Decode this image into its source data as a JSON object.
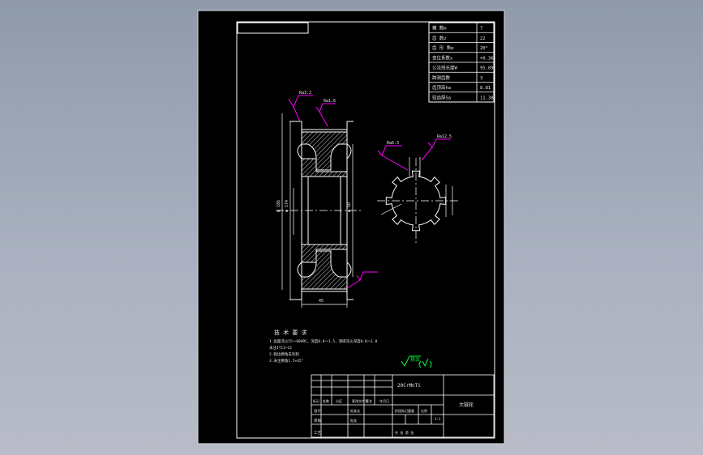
{
  "drawing": {
    "params": [
      {
        "label": "模    数m",
        "value": "7"
      },
      {
        "label": "齿    数z",
        "value": "22"
      },
      {
        "label": "齿 形 角α",
        "value": "20°"
      },
      {
        "label": "变位系数x",
        "value": "+0.36"
      },
      {
        "label": "公法线长度W",
        "value": "95.89"
      },
      {
        "label": "跨测齿数",
        "value": "3"
      },
      {
        "label": "齿顶高ha",
        "value": "8.81"
      },
      {
        "label": "弦齿厚Sa",
        "value": "11.38"
      }
    ],
    "tech_requirements": {
      "title": "技 术 要 求",
      "lines": [
        "1.齿面淬火55～60HRC，深度0.8～1.5，渗碳淬火深度0.8～1.0",
        "未注IT13~12",
        "2.锐边倒角去毛刺",
        "3.未注倒角1.5×45°"
      ]
    },
    "roughness_note": "其余",
    "title_block": {
      "material": "20CrMnTi",
      "part_name": "大链轮",
      "scale": "1:1",
      "headers": [
        "标记",
        "处数",
        "分区",
        "更改文件号",
        "签名",
        "年月日"
      ],
      "roles": [
        "设计",
        "审核",
        "工艺"
      ],
      "labels": [
        "标准化",
        "批准",
        "阶段标记",
        "重量",
        "比例",
        "共  张  第  张"
      ]
    },
    "dims": {
      "d_outer": "φ 186",
      "d_mid": "φ 174",
      "bore": "φ 60",
      "width": "45",
      "roughness_a": "Ra3.2",
      "roughness_b": "Ra1.6",
      "roughness_c": "Ra6.3",
      "roughness_d": "Ra12.5"
    }
  },
  "colors": {
    "paper": "#000000",
    "line": "#ffffff",
    "magenta": "#ff00ff",
    "green": "#00ff3c"
  }
}
